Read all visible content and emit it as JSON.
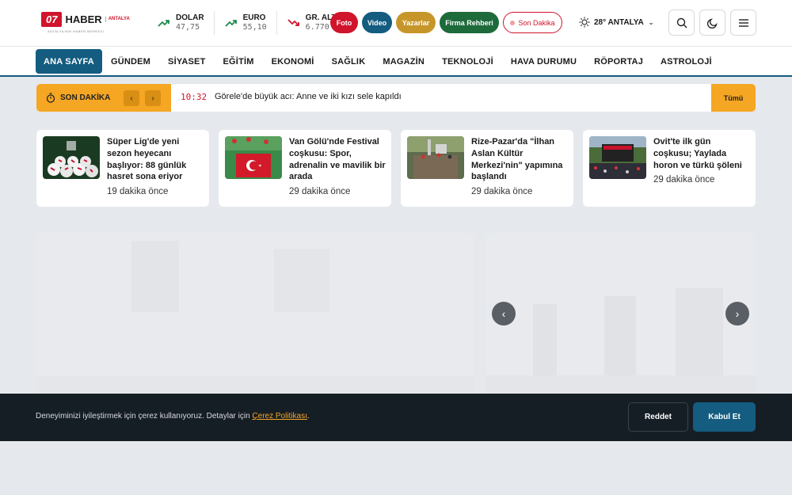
{
  "header": {
    "logo": {
      "badge": "07",
      "word": "HABER",
      "city": "ANTALYA",
      "tagline": "ANTALYA'NIN HABER MERKEZI"
    },
    "markets": [
      {
        "name": "DOLAR",
        "value": "47,75",
        "trend": "up"
      },
      {
        "name": "EURO",
        "value": "55,10",
        "trend": "up"
      },
      {
        "name": "GR. ALT",
        "value": "6.770",
        "trend": "down"
      }
    ],
    "pills": {
      "foto": "Foto",
      "video": "Video",
      "yazarlar": "Yazarlar",
      "firma": "Firma Rehberi",
      "son_dakika": "Son Dakika"
    },
    "weather": {
      "text": "28° ANTALYA",
      "icon": "sun-icon"
    }
  },
  "nav": {
    "items": [
      "ANA SAYFA",
      "GÜNDEM",
      "SİYASET",
      "EĞİTİM",
      "EKONOMİ",
      "SAĞLIK",
      "MAGAZİN",
      "TEKNOLOJİ",
      "HAVA DURUMU",
      "RÖPORTAJ",
      "ASTROLOJİ"
    ],
    "active": "ANA SAYFA"
  },
  "breaking": {
    "label": "SON DAKİKA",
    "time": "10:32",
    "text": "Görele'de büyük acı: Anne ve iki kızı sele kapıldı",
    "all_label": "Tümü"
  },
  "cards": [
    {
      "title": "Süper Lig'de yeni sezon heyecanı başlıyor: 88 günlük hasret sona eriyor",
      "time": "19 dakika önce"
    },
    {
      "title": "Van Gölü'nde Festival coşkusu: Spor, adrenalin ve mavilik bir arada",
      "time": "29 dakika önce"
    },
    {
      "title": "Rize-Pazar'da \"İlhan Aslan Kültür Merkezi'nin\" yapımına başlandı",
      "time": "29 dakika önce"
    },
    {
      "title": "Ovit'te ilk gün coşkusu; Yaylada horon ve türkü şöleni",
      "time": "29 dakika önce"
    }
  ],
  "cookie": {
    "text": "Deneyiminizi iyileştirmek için çerez kullanıyoruz. Detaylar için ",
    "link": "Çerez Politikası",
    "suffix": ".",
    "reject": "Reddet",
    "accept": "Kabul Et"
  },
  "colors": {
    "brand_red": "#d0142c",
    "brand_blue": "#145c80",
    "accent_orange": "#f5a623"
  }
}
